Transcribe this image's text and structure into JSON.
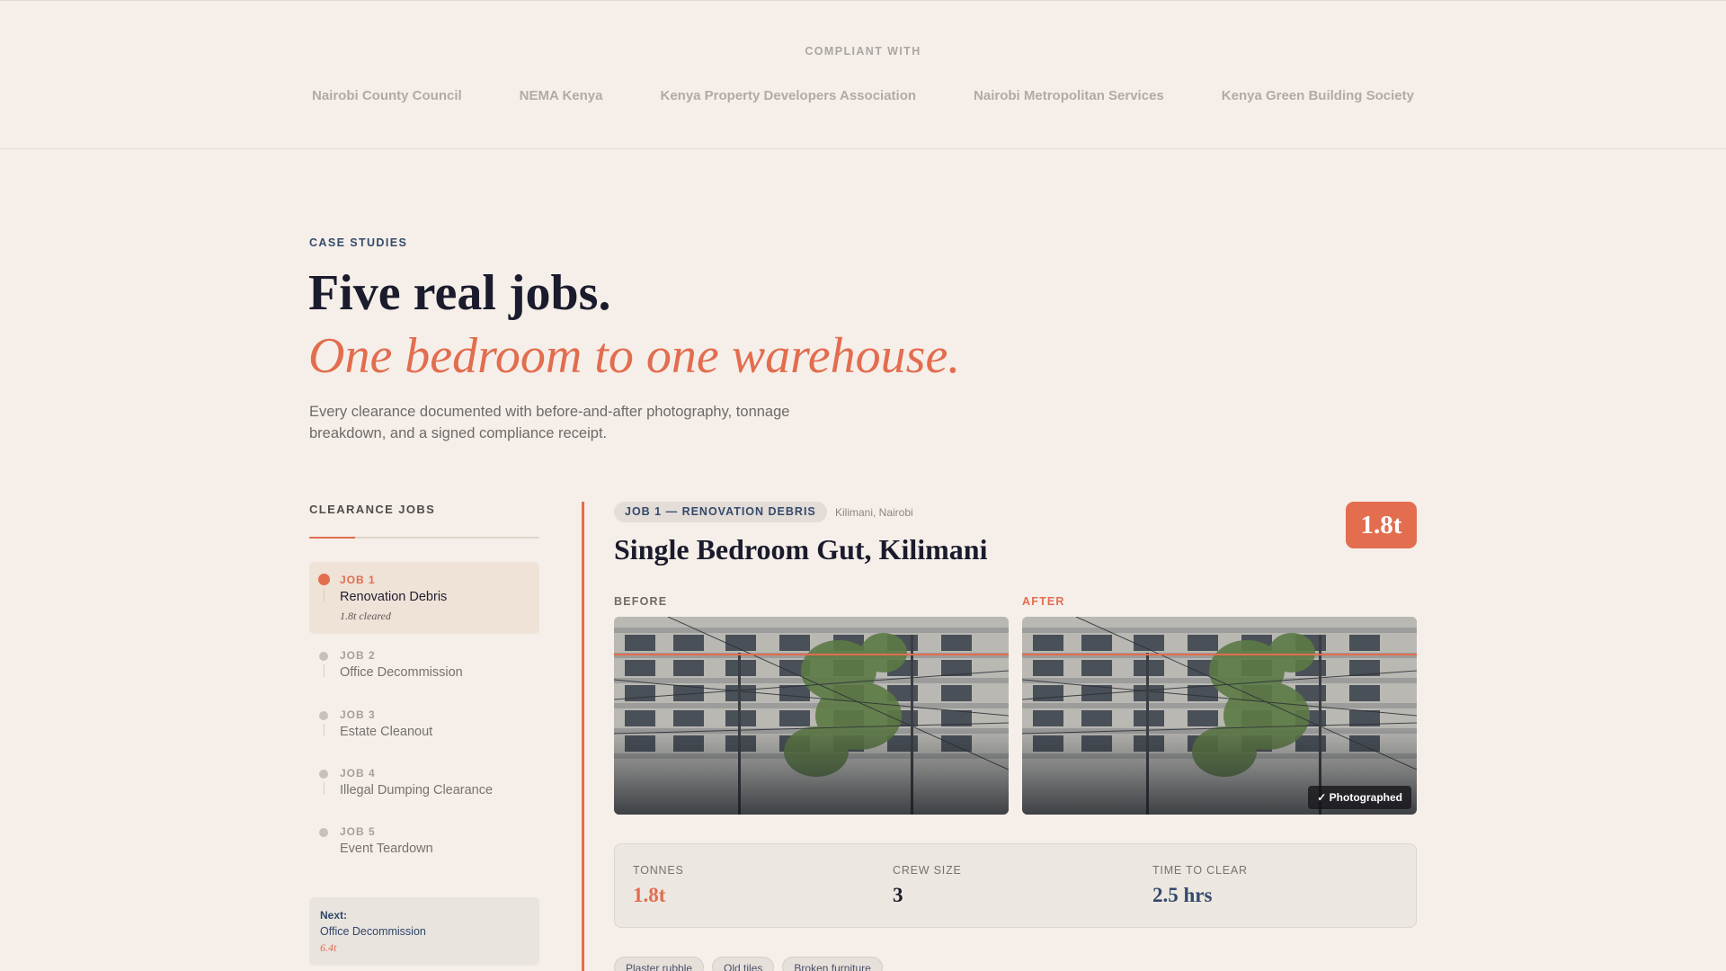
{
  "compliance": {
    "label": "COMPLIANT WITH",
    "orgs": [
      "Nairobi County Council",
      "NEMA Kenya",
      "Kenya Property Developers Association",
      "Nairobi Metropolitan Services",
      "Kenya Green Building Society"
    ]
  },
  "hero": {
    "eyebrow": "CASE STUDIES",
    "headline": "Five real jobs.",
    "headline_accent": "One bedroom to one warehouse.",
    "lede": "Every clearance documented with before-and-after photography, tonnage breakdown, and a signed compliance receipt."
  },
  "sidebar": {
    "title": "CLEARANCE JOBS",
    "jobs": [
      {
        "num": "JOB 1",
        "name": "Renovation Debris",
        "cleared": "1.8t cleared",
        "active": true
      },
      {
        "num": "JOB 2",
        "name": "Office Decommission"
      },
      {
        "num": "JOB 3",
        "name": "Estate Cleanout"
      },
      {
        "num": "JOB 4",
        "name": "Illegal Dumping Clearance"
      },
      {
        "num": "JOB 5",
        "name": "Event Teardown"
      }
    ],
    "next": {
      "label": "Next:",
      "name": "Office Decommission",
      "tonnes": "6.4t"
    }
  },
  "job": {
    "pill": "JOB 1 — RENOVATION DEBRIS",
    "location": "Kilimani, Nairobi",
    "title": "Single Bedroom Gut, Kilimani",
    "tonnes_badge": "1.8t",
    "before_label": "BEFORE",
    "after_label": "AFTER",
    "photo_stamp": "✓ Photographed",
    "stats": [
      {
        "label": "TONNES",
        "value": "1.8t"
      },
      {
        "label": "CREW SIZE",
        "value": "3"
      },
      {
        "label": "TIME TO CLEAR",
        "value": "2.5 hrs"
      }
    ],
    "tags": [
      "Plaster rubble",
      "Old tiles",
      "Broken furniture"
    ]
  },
  "colors": {
    "accent": "#e26d4f",
    "navy": "#334a6b",
    "background": "#f6efe9"
  }
}
